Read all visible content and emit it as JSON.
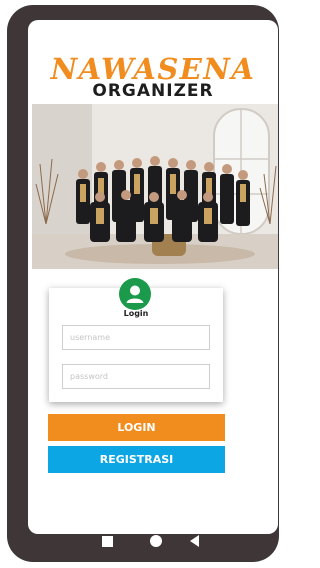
{
  "app": {
    "logo_title": "NAWASENA",
    "logo_subtitle": "ORGANIZER"
  },
  "login_card": {
    "title": "Login",
    "username_placeholder": "username",
    "password_placeholder": "password"
  },
  "buttons": {
    "login_label": "LOGIN",
    "register_label": "REGISTRASI"
  },
  "colors": {
    "accent_orange": "#f18c1f",
    "accent_blue": "#0da6e5",
    "avatar_green": "#1a9a4a",
    "phone_frame": "#3f3637"
  },
  "icons": {
    "avatar": "user-icon",
    "nav_recent": "square-icon",
    "nav_home": "circle-icon",
    "nav_back": "triangle-back-icon"
  }
}
